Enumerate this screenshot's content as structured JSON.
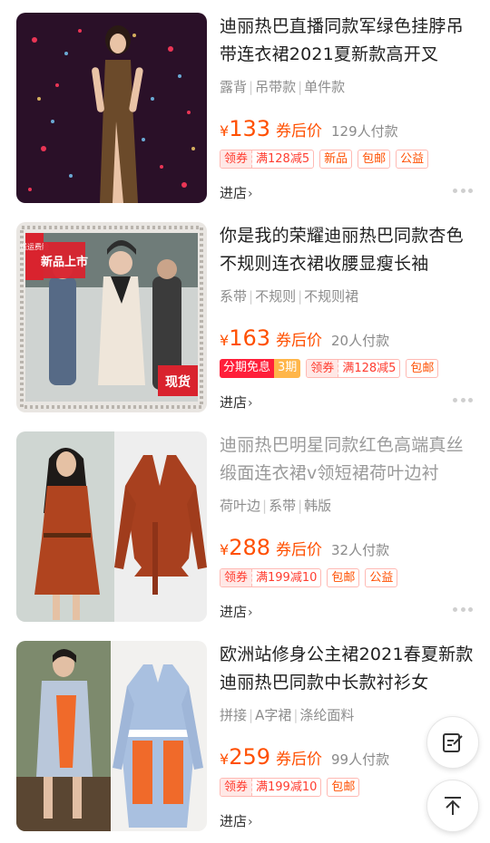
{
  "products": [
    {
      "title": "迪丽热巴直播同款军绿色挂脖吊带连衣裙2021夏新款高开叉",
      "attrs": [
        "露背",
        "吊带款",
        "单件款"
      ],
      "currency": "¥",
      "price": "133",
      "price_label": "券后价",
      "paid": "129人付款",
      "coupon": {
        "label": "领券",
        "value": "满128减5"
      },
      "tags": [
        "新品",
        "包邮",
        "公益"
      ],
      "store": "进店"
    },
    {
      "title": "你是我的荣耀迪丽热巴同款杏色不规则连衣裙收腰显瘦长袖",
      "attrs": [
        "系带",
        "不规则",
        "不规则裙"
      ],
      "currency": "¥",
      "price": "163",
      "price_label": "券后价",
      "paid": "20人付款",
      "installment": {
        "label": "分期免息",
        "value": "3期"
      },
      "coupon": {
        "label": "领券",
        "value": "满128减5"
      },
      "tags": [
        "包邮"
      ],
      "store": "进店",
      "image_badges": {
        "corner": "送运费险",
        "logo": "新品上市",
        "stamp": "现货"
      }
    },
    {
      "title": "迪丽热巴明星同款红色高端真丝缎面连衣裙v领短裙荷叶边衬",
      "attrs": [
        "荷叶边",
        "系带",
        "韩版"
      ],
      "currency": "¥",
      "price": "288",
      "price_label": "券后价",
      "paid": "32人付款",
      "coupon": {
        "label": "领券",
        "value": "满199减10"
      },
      "tags": [
        "包邮",
        "公益"
      ],
      "store": "进店"
    },
    {
      "title": "欧洲站修身公主裙2021春夏新款迪丽热巴同款中长款衬衫女",
      "attrs": [
        "拼接",
        "A字裙",
        "涤纶面料"
      ],
      "currency": "¥",
      "price": "259",
      "price_label": "券后价",
      "paid": "99人付款",
      "coupon": {
        "label": "领券",
        "value": "满199减10"
      },
      "tags": [
        "包邮"
      ],
      "store": "进店"
    }
  ],
  "fabs": {
    "feedback_icon": "edit-note-icon",
    "top_icon": "back-to-top-icon"
  },
  "colors": {
    "price": "#ff4f00",
    "coupon_bg": "#ffe8e6",
    "installment": "#ff1f3a"
  }
}
